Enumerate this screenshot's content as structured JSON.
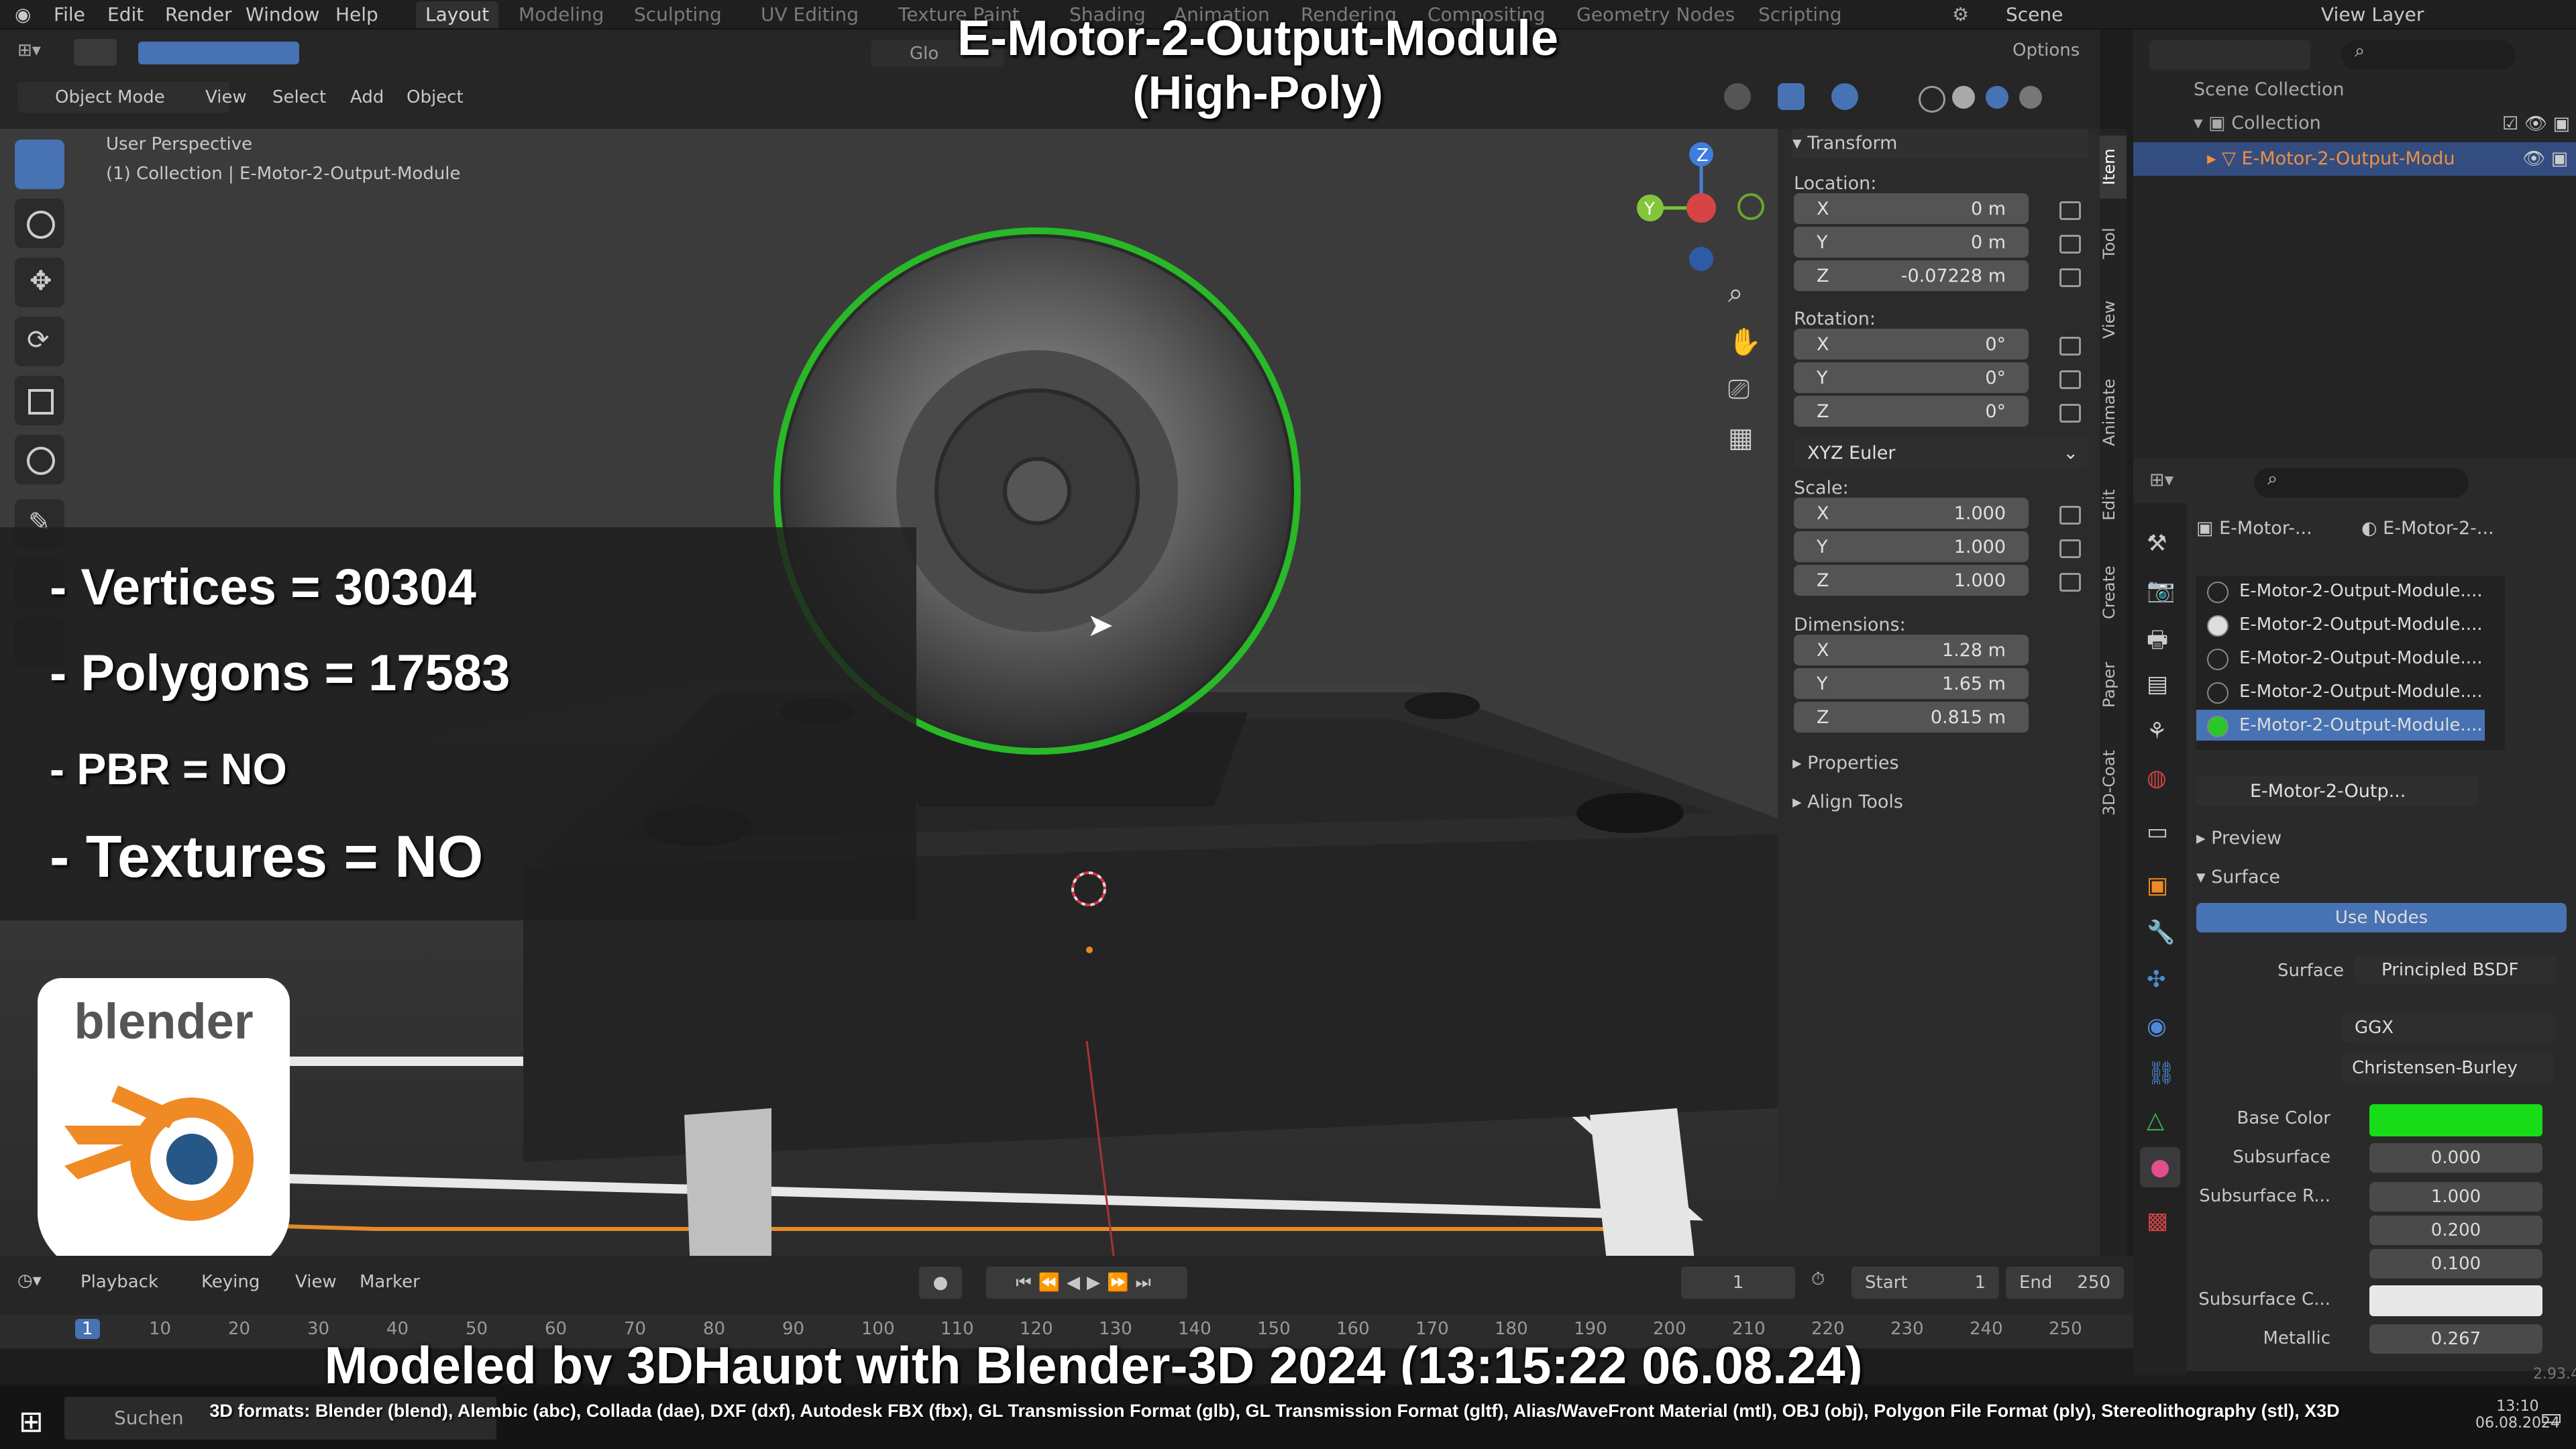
{
  "menu": {
    "file": "File",
    "edit": "Edit",
    "render": "Render",
    "window": "Window",
    "help": "Help"
  },
  "workspaces": [
    "Layout",
    "Modeling",
    "Sculpting",
    "UV Editing",
    "Texture Paint",
    "Shading",
    "Animation",
    "Rendering",
    "Compositing",
    "Geometry Nodes",
    "Scripting"
  ],
  "scene_label": "Scene",
  "view_layer_label": "View Layer",
  "overlay": {
    "title_line1": "E-Motor-2-Output-Module",
    "title_line2": "(High-Poly)",
    "vertices": "- Vertices = 30304",
    "polygons": "- Polygons = 17583",
    "pbr": "- PBR =  NO",
    "textures": "- Textures = NO",
    "footer": "Modeled by 3DHaupt with Blender-3D 2024 (13:15:22  06.08.24)",
    "formats": "3D formats: Blender (blend), Alembic (abc), Collada (dae), DXF (dxf), Autodesk FBX (fbx), GL Transmission Format (glb), GL Transmission Format (gltf), Alias/WaveFront Material (mtl), OBJ (obj), Polygon File Format (ply), Stereolithography (stl), X3D",
    "logo_text": "blender"
  },
  "viewport_header": {
    "mode": "Object Mode",
    "view": "View",
    "select": "Select",
    "add": "Add",
    "object": "Object",
    "options": "Options",
    "transform_orient": "Glo"
  },
  "viewport_info": {
    "line1": "User Perspective",
    "line2": "(1) Collection | E-Motor-2-Output-Module"
  },
  "gizmo": {
    "x": "Y",
    "z": "Z"
  },
  "npanel": {
    "transform": "Transform",
    "location": "Location:",
    "loc": [
      {
        "axis": "X",
        "value": "0 m"
      },
      {
        "axis": "Y",
        "value": "0 m"
      },
      {
        "axis": "Z",
        "value": "-0.07228 m"
      }
    ],
    "rotation": "Rotation:",
    "rot": [
      {
        "axis": "X",
        "value": "0°"
      },
      {
        "axis": "Y",
        "value": "0°"
      },
      {
        "axis": "Z",
        "value": "0°"
      }
    ],
    "rot_mode": "XYZ Euler",
    "scale": "Scale:",
    "scl": [
      {
        "axis": "X",
        "value": "1.000"
      },
      {
        "axis": "Y",
        "value": "1.000"
      },
      {
        "axis": "Z",
        "value": "1.000"
      }
    ],
    "dimensions": "Dimensions:",
    "dim": [
      {
        "axis": "X",
        "value": "1.28 m"
      },
      {
        "axis": "Y",
        "value": "1.65 m"
      },
      {
        "axis": "Z",
        "value": "0.815 m"
      }
    ],
    "properties": "Properties",
    "align_tools": "Align Tools",
    "tabs": [
      "Item",
      "Tool",
      "View",
      "Animate",
      "Edit",
      "Create",
      "Paper",
      "3D-Coat"
    ]
  },
  "outliner": {
    "scene_collection": "Scene Collection",
    "collection": "Collection",
    "object": "E-Motor-2-Output-Modu"
  },
  "properties": {
    "object_name": "E-Motor-...",
    "material_name": "E-Motor-2-...",
    "slots": [
      "E-Motor-2-Output-Module....",
      "E-Motor-2-Output-Module....",
      "E-Motor-2-Output-Module....",
      "E-Motor-2-Output-Module....",
      "E-Motor-2-Output-Module...."
    ],
    "material_field": "E-Motor-2-Outp...",
    "preview": "Preview",
    "surface_section": "Surface",
    "use_nodes": "Use Nodes",
    "surface_label": "Surface",
    "surface_value": "Principled BSDF",
    "distribution": "GGX",
    "subsurface_method": "Christensen-Burley",
    "base_color_label": "Base Color",
    "base_color": "#18dc18",
    "subsurface_label": "Subsurface",
    "subsurface_value": "0.000",
    "subsurface_r_label": "Subsurface R...",
    "subsurface_r": [
      "1.000",
      "0.200",
      "0.100"
    ],
    "subsurface_c_label": "Subsurface C...",
    "metallic_label": "Metallic",
    "metallic_value": "0.267"
  },
  "timeline": {
    "playback": "Playback",
    "keying": "Keying",
    "view": "View",
    "marker": "Marker",
    "current_frame": "1",
    "start_label": "Start",
    "start": "1",
    "end_label": "End",
    "end": "250",
    "ticks": [
      "1",
      "10",
      "20",
      "30",
      "40",
      "50",
      "60",
      "70",
      "80",
      "90",
      "100",
      "110",
      "120",
      "130",
      "140",
      "150",
      "160",
      "170",
      "180",
      "190",
      "200",
      "210",
      "220",
      "230",
      "240",
      "250"
    ]
  },
  "taskbar": {
    "search": "Suchen",
    "time": "13:10",
    "date": "06.08.2024"
  },
  "version": "2.93.4"
}
